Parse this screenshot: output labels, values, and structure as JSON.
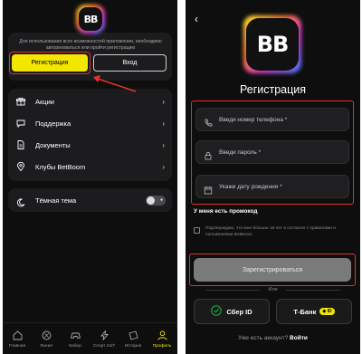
{
  "left_screen": {
    "logo_text": "BB",
    "auth_hint": "Для использования всех возможностей приложения, необходимо авторизоваться или пройти регистрацию",
    "register_label": "Регистрация",
    "login_label": "Вход",
    "menu": [
      {
        "label": "Акции",
        "icon": "gift-icon"
      },
      {
        "label": "Поддержка",
        "icon": "chat-icon"
      },
      {
        "label": "Документы",
        "icon": "document-icon"
      },
      {
        "label": "Клубы BetBoom",
        "icon": "location-pin-icon"
      }
    ],
    "theme_label": "Тёмная тема",
    "dark_theme_on": false,
    "tabs": [
      {
        "label": "Главная",
        "icon": "home-icon"
      },
      {
        "label": "Линия",
        "icon": "ball-icon"
      },
      {
        "label": "Кибер",
        "icon": "gamepad-icon"
      },
      {
        "label": "Спорт 24/7",
        "icon": "lightning-icon"
      },
      {
        "label": "История",
        "icon": "ticket-icon"
      },
      {
        "label": "Профиль",
        "icon": "person-icon",
        "active": true
      }
    ],
    "accent_color": "#f3e600",
    "highlight_color": "#e0322a"
  },
  "right_screen": {
    "logo_text": "BB",
    "title": "Регистрация",
    "phone_placeholder": "Введи номер телефона *",
    "password_placeholder": "Введи пароль *",
    "birthdate_placeholder": "Укажи дату рождения *",
    "promo_label": "У меня есть промокод",
    "agreement_text": "Подтверждаю, что мне больше 18 лет и согласен с правилами и положениями",
    "agreement_link": "BetBoom",
    "submit_label": "Зарегистрироваться",
    "or_label": "Или",
    "sber_label": "Сбер ID",
    "tbank_label": "Т-Банк",
    "tbank_badge": "ID",
    "have_account_text": "Уже есть аккаунт?",
    "login_link": "Войти"
  }
}
